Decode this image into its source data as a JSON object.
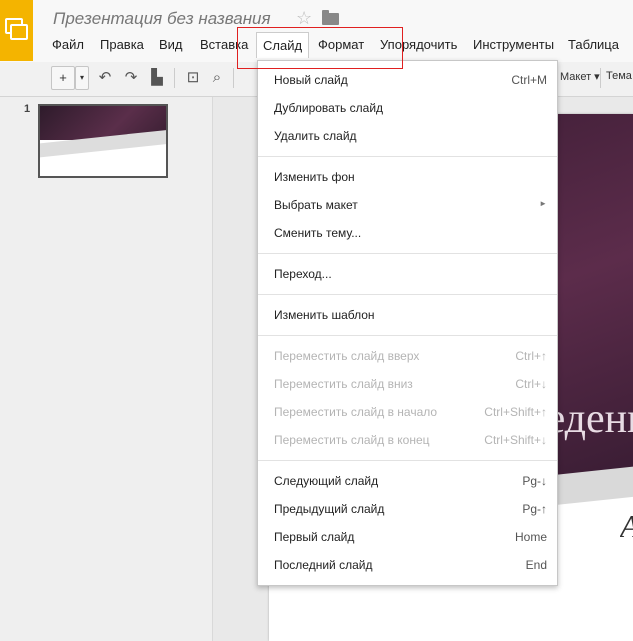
{
  "title": "Презентация без названия",
  "menu": [
    "Файл",
    "Правка",
    "Вид",
    "Вставка",
    "Слайд",
    "Формат",
    "Упорядочить",
    "Инструменты",
    "Таблица"
  ],
  "toolbar": {
    "plus": "+",
    "layout_label": "Макет ▾",
    "theme_label": "Тема"
  },
  "filmstrip": {
    "slide_number": "1"
  },
  "slide": {
    "title_fragment": "ведение",
    "subtitle_fragment": "A"
  },
  "slide_menu": {
    "groups": [
      [
        {
          "label": "Новый слайд",
          "shortcut": "Ctrl+M"
        },
        {
          "label": "Дублировать слайд",
          "shortcut": ""
        },
        {
          "label": "Удалить слайд",
          "shortcut": ""
        }
      ],
      [
        {
          "label": "Изменить фон",
          "shortcut": ""
        },
        {
          "label": "Выбрать макет",
          "shortcut": ""
        },
        {
          "label": "Сменить тему...",
          "shortcut": ""
        }
      ],
      [
        {
          "label": "Переход...",
          "shortcut": ""
        }
      ],
      [
        {
          "label": "Изменить шаблон",
          "shortcut": ""
        }
      ],
      [
        {
          "label": "Переместить слайд вверх",
          "shortcut": "Ctrl+↑"
        },
        {
          "label": "Переместить слайд вниз",
          "shortcut": "Ctrl+↓"
        },
        {
          "label": "Переместить слайд в начало",
          "shortcut": "Ctrl+Shift+↑"
        },
        {
          "label": "Переместить слайд в конец",
          "shortcut": "Ctrl+Shift+↓"
        }
      ],
      [
        {
          "label": "Следующий слайд",
          "shortcut": "Pg-↓"
        },
        {
          "label": "Предыдущий слайд",
          "shortcut": "Pg-↑"
        },
        {
          "label": "Первый слайд",
          "shortcut": "Home"
        },
        {
          "label": "Последний слайд",
          "shortcut": "End"
        }
      ]
    ]
  },
  "colors": {
    "app_icon": "#f4b400",
    "highlight": "#e02020",
    "slide_dark": "#4a2540"
  }
}
